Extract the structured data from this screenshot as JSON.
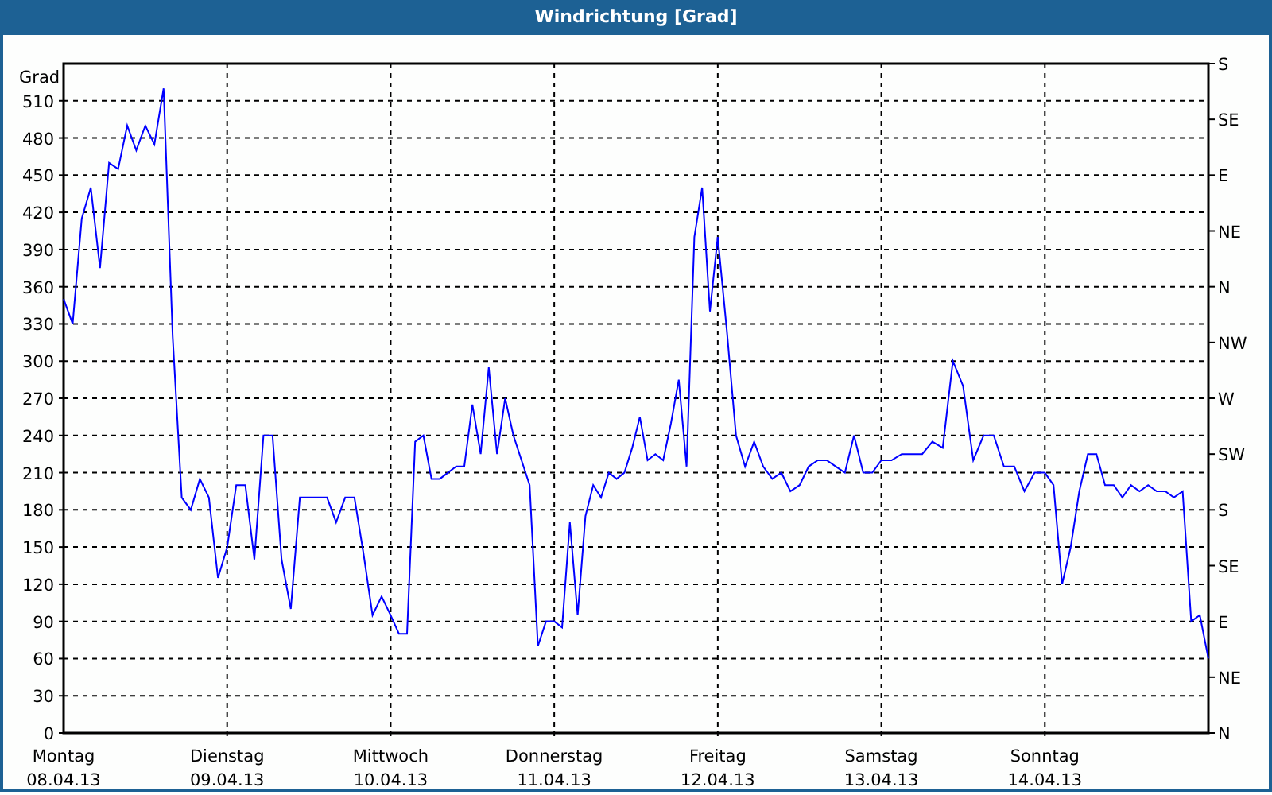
{
  "window": {
    "title": "Windrichtung [Grad]"
  },
  "chart": {
    "right_axis_labels": [
      "S",
      "SE",
      "E",
      "NE",
      "N",
      "NW",
      "W",
      "SW",
      "S",
      "SE",
      "E",
      "NE",
      "N"
    ],
    "dates": [
      "08.04.13",
      "09.04.13",
      "10.04.13",
      "11.04.13",
      "12.04.13",
      "13.04.13",
      "14.04.13"
    ],
    "chart_data": {
      "type": "line",
      "grid": true,
      "ylabel": "Grad",
      "ylim": [
        0,
        540
      ],
      "categories": [
        "Montag",
        null,
        null,
        null,
        null,
        null,
        null,
        null,
        null,
        null,
        null,
        null,
        null,
        null,
        null,
        null,
        null,
        null,
        "Dienstag",
        null,
        null,
        null,
        null,
        null,
        null,
        null,
        null,
        null,
        null,
        null,
        null,
        null,
        null,
        null,
        null,
        null,
        "Mittwoch",
        null,
        null,
        null,
        null,
        null,
        null,
        null,
        null,
        null,
        null,
        null,
        null,
        null,
        null,
        null,
        null,
        null,
        null,
        null,
        "Donnerstag",
        null,
        null,
        null,
        null,
        null,
        null,
        null,
        null,
        null,
        null,
        null,
        null,
        null,
        null,
        null,
        null,
        null,
        null,
        null,
        null,
        "Freitag",
        null,
        null,
        null,
        null,
        null,
        null,
        null,
        null,
        null,
        null,
        null,
        null,
        null,
        null,
        null,
        null,
        null,
        "Samstag",
        null,
        null,
        null,
        null,
        null,
        null,
        null,
        null,
        null,
        null,
        null,
        null,
        null,
        null,
        null,
        "Sonntag",
        null,
        null,
        null,
        null,
        null,
        null,
        null,
        null,
        null,
        null,
        null,
        null,
        null,
        null,
        null,
        null,
        null,
        null,
        null
      ],
      "yticks": [
        {
          "value": 0,
          "label": "0"
        },
        {
          "value": 30,
          "label": "30"
        },
        {
          "value": 60,
          "label": "60"
        },
        {
          "value": 90,
          "label": "90"
        },
        {
          "value": 120,
          "label": "120"
        },
        {
          "value": 150,
          "label": "150"
        },
        {
          "value": 180,
          "label": "180"
        },
        {
          "value": 210,
          "label": "210"
        },
        {
          "value": 240,
          "label": "240"
        },
        {
          "value": 270,
          "label": "270"
        },
        {
          "value": 300,
          "label": "300"
        },
        {
          "value": 330,
          "label": "330"
        },
        {
          "value": 360,
          "label": "360"
        },
        {
          "value": 390,
          "label": "390"
        },
        {
          "value": 420,
          "label": "420"
        },
        {
          "value": 450,
          "label": "450"
        },
        {
          "value": 480,
          "label": "480"
        },
        {
          "value": 510,
          "label": "510"
        }
      ],
      "series": [
        {
          "color": "#0000ff",
          "values": [
            350,
            330,
            415,
            440,
            375,
            460,
            455,
            490,
            470,
            490,
            475,
            520,
            320,
            190,
            180,
            205,
            190,
            125,
            150,
            200,
            200,
            140,
            240,
            240,
            140,
            100,
            190,
            190,
            190,
            190,
            170,
            190,
            190,
            145,
            95,
            110,
            95,
            80,
            80,
            235,
            240,
            205,
            205,
            210,
            215,
            215,
            265,
            225,
            295,
            225,
            270,
            240,
            220,
            200,
            70,
            90,
            90,
            85,
            170,
            95,
            175,
            200,
            190,
            210,
            205,
            210,
            230,
            255,
            220,
            225,
            220,
            250,
            285,
            215,
            400,
            440,
            340,
            400,
            325,
            240,
            215,
            235,
            215,
            205,
            210,
            195,
            200,
            215,
            220,
            220,
            215,
            210,
            240,
            210,
            210,
            220,
            220,
            225,
            225,
            225,
            235,
            230,
            300,
            280,
            220,
            240,
            240,
            215,
            215,
            195,
            210,
            210,
            200,
            120,
            150,
            195,
            225,
            225,
            200,
            200,
            190,
            200,
            195,
            200,
            195,
            195,
            190,
            195,
            90,
            95,
            60
          ]
        }
      ]
    }
  }
}
